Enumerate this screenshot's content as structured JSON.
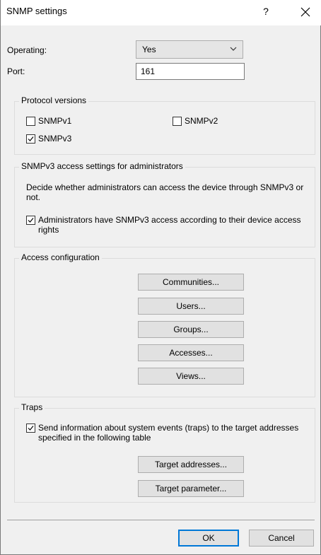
{
  "title": "SNMP settings",
  "help_glyph": "?",
  "operating": {
    "label": "Operating:",
    "value": "Yes"
  },
  "port": {
    "label": "Port:",
    "value": "161"
  },
  "protocol": {
    "title": "Protocol versions",
    "v1": {
      "label": "SNMPv1",
      "checked": false
    },
    "v2": {
      "label": "SNMPv2",
      "checked": false
    },
    "v3": {
      "label": "SNMPv3",
      "checked": true
    }
  },
  "snmpv3_access": {
    "title": "SNMPv3 access settings for administrators",
    "description": "Decide whether administrators can access the device through SNMPv3 or not.",
    "checkbox_label": "Administrators have SNMPv3 access according to their device access rights",
    "checked": true
  },
  "access_config": {
    "title": "Access configuration",
    "buttons": [
      "Communities...",
      "Users...",
      "Groups...",
      "Accesses...",
      "Views..."
    ]
  },
  "traps": {
    "title": "Traps",
    "checkbox_label": "Send information about system events (traps) to the target addresses specified in the following table",
    "checked": true,
    "buttons": [
      "Target addresses...",
      "Target parameter..."
    ]
  },
  "footer": {
    "ok": "OK",
    "cancel": "Cancel"
  }
}
